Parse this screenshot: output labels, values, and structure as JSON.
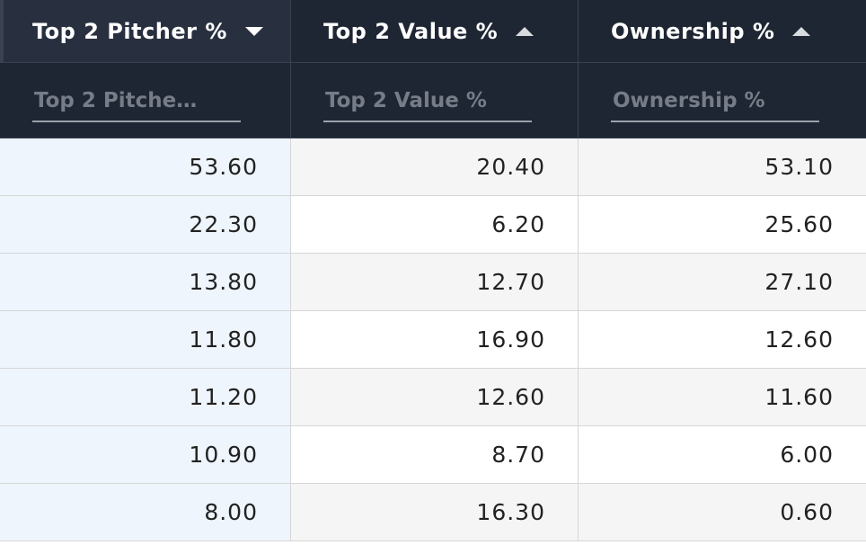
{
  "columns": [
    {
      "label": "Top 2 Pitcher %",
      "sort": "desc",
      "filter_placeholder": "Top 2 Pitche…"
    },
    {
      "label": "Top 2 Value %",
      "sort": "asc",
      "filter_placeholder": "Top 2 Value %"
    },
    {
      "label": "Ownership %",
      "sort": "asc",
      "filter_placeholder": "Ownership %"
    }
  ],
  "rows": [
    [
      "53.60",
      "20.40",
      "53.10"
    ],
    [
      "22.30",
      "6.20",
      "25.60"
    ],
    [
      "13.80",
      "12.70",
      "27.10"
    ],
    [
      "11.80",
      "16.90",
      "12.60"
    ],
    [
      "11.20",
      "12.60",
      "11.60"
    ],
    [
      "10.90",
      "8.70",
      "6.00"
    ],
    [
      "8.00",
      "16.30",
      "0.60"
    ]
  ],
  "icons": {
    "sort_desc": "caret-down-icon",
    "sort_asc": "caret-up-icon"
  },
  "colors": {
    "header_bg": "#1f2633",
    "highlight_column": "#eef5fd"
  }
}
